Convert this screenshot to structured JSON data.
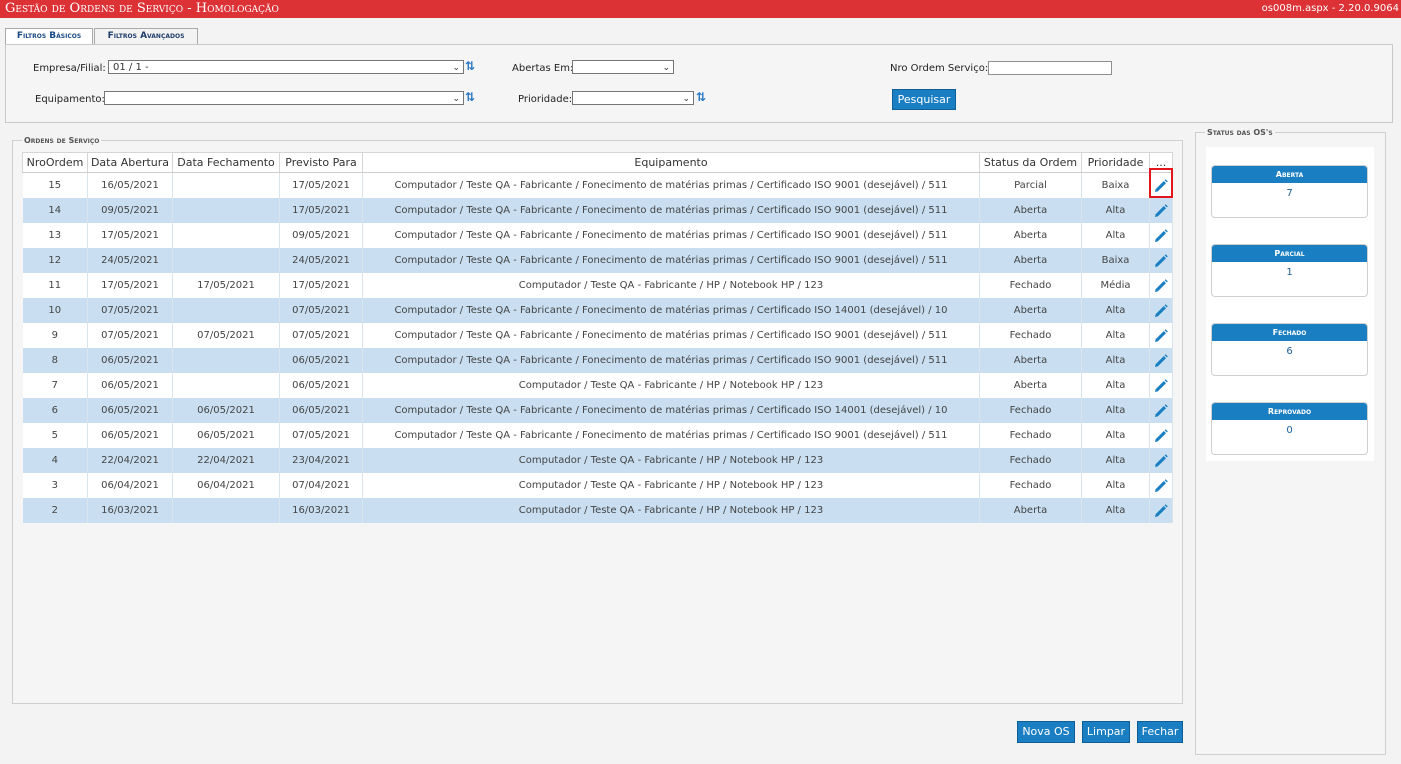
{
  "title": "Gestão de Ordens de Serviço  - Homologação",
  "version": "os008m.aspx - 2.20.0.9064",
  "tabs": [
    "Filtros Básicos",
    "Filtros Avançados"
  ],
  "filters": {
    "empresa_label": "Empresa/Filial:",
    "empresa_value": "01 / 1 -",
    "abertas_label": "Abertas Em:",
    "abertas_value": "",
    "nro_label": "Nro Ordem Serviço:",
    "nro_value": "",
    "equipamento_label": "Equipamento:",
    "equipamento_value": "",
    "prioridade_label": "Prioridade:",
    "prioridade_value": "",
    "pesquisar": "Pesquisar"
  },
  "orders": {
    "legend": "Ordens de Serviço",
    "columns": [
      "NroOrdem",
      "Data Abertura",
      "Data Fechamento",
      "Previsto Para",
      "Equipamento",
      "Status da Ordem",
      "Prioridade",
      "..."
    ],
    "rows": [
      [
        "15",
        "16/05/2021",
        "",
        "17/05/2021",
        "Computador / Teste QA - Fabricante / Fonecimento de matérias primas / Certificado ISO 9001 (desejável) / 511",
        "Parcial",
        "Baixa"
      ],
      [
        "14",
        "09/05/2021",
        "",
        "17/05/2021",
        "Computador / Teste QA - Fabricante / Fonecimento de matérias primas / Certificado ISO 9001 (desejável) / 511",
        "Aberta",
        "Alta"
      ],
      [
        "13",
        "17/05/2021",
        "",
        "09/05/2021",
        "Computador / Teste QA - Fabricante / Fonecimento de matérias primas / Certificado ISO 9001 (desejável) / 511",
        "Aberta",
        "Alta"
      ],
      [
        "12",
        "24/05/2021",
        "",
        "24/05/2021",
        "Computador / Teste QA - Fabricante / Fonecimento de matérias primas / Certificado ISO 9001 (desejável) / 511",
        "Aberta",
        "Baixa"
      ],
      [
        "11",
        "17/05/2021",
        "17/05/2021",
        "17/05/2021",
        "Computador / Teste QA - Fabricante / HP / Notebook HP / 123",
        "Fechado",
        "Média"
      ],
      [
        "10",
        "07/05/2021",
        "",
        "07/05/2021",
        "Computador / Teste QA - Fabricante / Fonecimento de matérias primas / Certificado ISO 14001 (desejável) / 10",
        "Aberta",
        "Alta"
      ],
      [
        "9",
        "07/05/2021",
        "07/05/2021",
        "07/05/2021",
        "Computador / Teste QA - Fabricante / Fonecimento de matérias primas / Certificado ISO 9001 (desejável) / 511",
        "Fechado",
        "Alta"
      ],
      [
        "8",
        "06/05/2021",
        "",
        "06/05/2021",
        "Computador / Teste QA - Fabricante / Fonecimento de matérias primas / Certificado ISO 9001 (desejável) / 511",
        "Aberta",
        "Alta"
      ],
      [
        "7",
        "06/05/2021",
        "",
        "06/05/2021",
        "Computador / Teste QA - Fabricante / HP / Notebook HP / 123",
        "Aberta",
        "Alta"
      ],
      [
        "6",
        "06/05/2021",
        "06/05/2021",
        "06/05/2021",
        "Computador / Teste QA - Fabricante / Fonecimento de matérias primas / Certificado ISO 14001 (desejável) / 10",
        "Fechado",
        "Alta"
      ],
      [
        "5",
        "06/05/2021",
        "06/05/2021",
        "07/05/2021",
        "Computador / Teste QA - Fabricante / Fonecimento de matérias primas / Certificado ISO 9001 (desejável) / 511",
        "Fechado",
        "Alta"
      ],
      [
        "4",
        "22/04/2021",
        "22/04/2021",
        "23/04/2021",
        "Computador / Teste QA - Fabricante / HP / Notebook HP / 123",
        "Fechado",
        "Alta"
      ],
      [
        "3",
        "06/04/2021",
        "06/04/2021",
        "07/04/2021",
        "Computador / Teste QA - Fabricante / HP / Notebook HP / 123",
        "Fechado",
        "Alta"
      ],
      [
        "2",
        "16/03/2021",
        "",
        "16/03/2021",
        "Computador / Teste QA - Fabricante / HP / Notebook HP / 123",
        "Aberta",
        "Alta"
      ]
    ],
    "edit_icon": "pencil-icon"
  },
  "status": {
    "legend": "Status das OS's",
    "cards": [
      {
        "label": "Aberta",
        "count": "7"
      },
      {
        "label": "Parcial",
        "count": "1"
      },
      {
        "label": "Fechado",
        "count": "6"
      },
      {
        "label": "Reprovado",
        "count": "0"
      }
    ]
  },
  "actions": {
    "nova": "Nova OS",
    "limpar": "Limpar",
    "fechar": "Fechar"
  },
  "colors": {
    "title_bar": "#dc3135",
    "accent": "#1a7ec2",
    "row_alt": "#c9dff1",
    "highlight": "#e3151b"
  }
}
